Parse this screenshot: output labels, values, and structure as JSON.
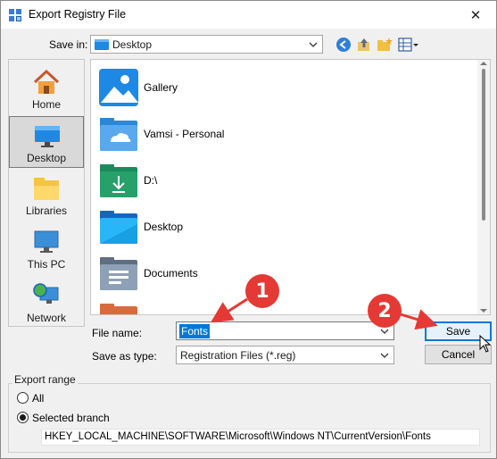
{
  "window": {
    "title": "Export Registry File",
    "close_glyph": "✕"
  },
  "save_in": {
    "label": "Save in:",
    "value": "Desktop"
  },
  "toolbar": {
    "icons": [
      "back-icon",
      "up-folder-icon",
      "new-folder-icon",
      "view-menu-icon"
    ]
  },
  "places": [
    {
      "label": "Home",
      "icon": "home-icon",
      "selected": false
    },
    {
      "label": "Desktop",
      "icon": "desktop-icon",
      "selected": true
    },
    {
      "label": "Libraries",
      "icon": "libraries-icon",
      "selected": false
    },
    {
      "label": "This PC",
      "icon": "this-pc-icon",
      "selected": false
    },
    {
      "label": "Network",
      "icon": "network-icon",
      "selected": false
    }
  ],
  "files": [
    {
      "name": "Gallery",
      "icon": "gallery-icon"
    },
    {
      "name": "Vamsi - Personal",
      "icon": "onedrive-folder-icon"
    },
    {
      "name": "D:\\",
      "icon": "download-folder-icon"
    },
    {
      "name": "Desktop",
      "icon": "desktop-folder-icon"
    },
    {
      "name": "Documents",
      "icon": "documents-folder-icon"
    }
  ],
  "file_name": {
    "label": "File name:",
    "value": "Fonts"
  },
  "save_as_type": {
    "label": "Save as type:",
    "value": "Registration Files (*.reg)"
  },
  "buttons": {
    "save": "Save",
    "cancel": "Cancel"
  },
  "export_range": {
    "title": "Export range",
    "all_label": "All",
    "selected_label": "Selected branch",
    "selected": "Selected branch",
    "key_path": "HKEY_LOCAL_MACHINE\\SOFTWARE\\Microsoft\\Windows NT\\CurrentVersion\\Fonts"
  },
  "annotations": {
    "badge1": "1",
    "badge2": "2",
    "color": "#e53935"
  },
  "colors": {
    "accent": "#0078d7",
    "folder": "#f6c445",
    "badge": "#e53935"
  }
}
